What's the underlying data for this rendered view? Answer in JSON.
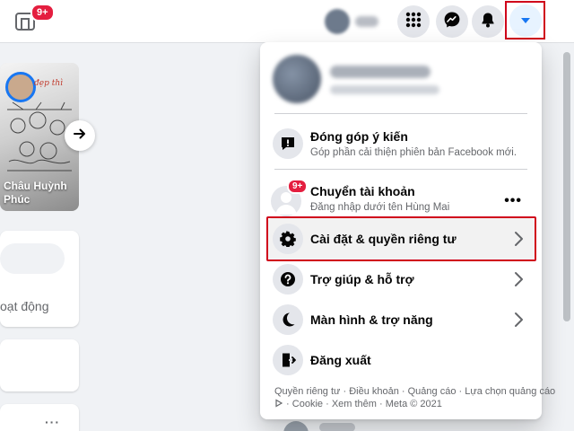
{
  "topbar": {
    "home_badge": "9+",
    "icons": [
      "home-icon",
      "apps-grid-icon",
      "messenger-icon",
      "bell-icon",
      "caret-down-icon"
    ]
  },
  "background": {
    "story": {
      "name": "Châu Huỳnh Phúc",
      "tag": "đẹp thì"
    },
    "activity_text": "oạt động",
    "more_text": "···"
  },
  "menu": {
    "feedback": {
      "label": "Đóng góp ý kiến",
      "sub": "Góp phần cải thiện phiên bản Facebook mới."
    },
    "switch_account": {
      "label": "Chuyển tài khoản",
      "sub": "Đăng nhập dưới tên Hùng Mai",
      "badge": "9+",
      "more": "•••"
    },
    "settings": {
      "label": "Cài đặt & quyền riêng tư"
    },
    "help": {
      "label": "Trợ giúp & hỗ trợ"
    },
    "display": {
      "label": "Màn hình & trợ năng"
    },
    "logout": {
      "label": "Đăng xuất"
    },
    "footer": {
      "privacy": "Quyền riêng tư",
      "terms": "Điều khoản",
      "ads": "Quảng cáo",
      "ad_choices": "Lựa chọn quảng cáo",
      "cookie": "Cookie",
      "more": "Xem thêm",
      "copyright": "Meta © 2021",
      "sep": " · "
    }
  },
  "colors": {
    "highlight": "#d0021b",
    "brand": "#1877f2",
    "badge": "#e41e3f"
  }
}
